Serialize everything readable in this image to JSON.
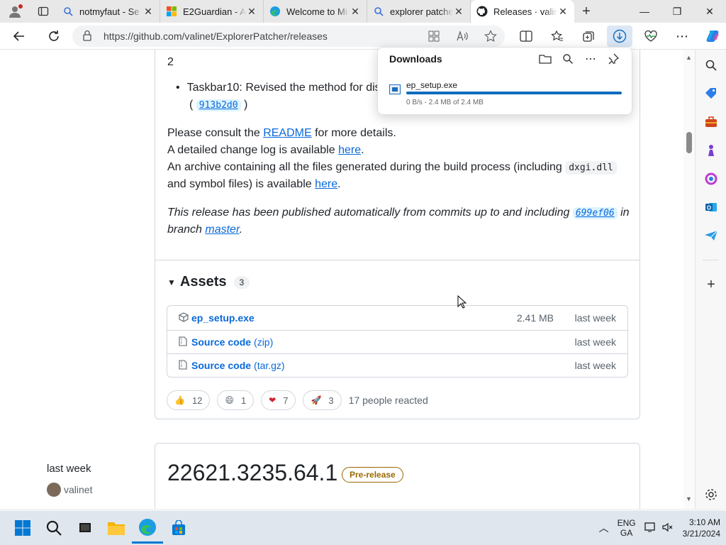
{
  "browser": {
    "tabs": [
      {
        "title": "notmyfaut - Se",
        "icon": "search-icon"
      },
      {
        "title": "E2Guardian - A",
        "icon": "microsoft-icon"
      },
      {
        "title": "Welcome to Mi",
        "icon": "edge-icon"
      },
      {
        "title": "explorer patche",
        "icon": "search-icon"
      },
      {
        "title": "Releases · valin",
        "icon": "github-icon",
        "active": true
      }
    ],
    "url": "https://github.com/valinet/ExplorerPatcher/releases"
  },
  "downloads": {
    "title": "Downloads",
    "file_name": "ep_setup.exe",
    "status": "0 B/s - 2.4 MB of 2.4 MB",
    "progress": 1.0
  },
  "release": {
    "top_number": "2",
    "bullet": "Taskbar10: Revised the method for dis",
    "bullet_sha": "913b2d0",
    "p1_pre": "Please consult the ",
    "p1_link": "README",
    "p1_post": " for more details.",
    "p2_pre": "A detailed change log is available ",
    "p2_link": "here",
    "p2_post": ".",
    "p3_pre": "An archive containing all the files generated during the build process (including ",
    "p3_code": "dxgi.dll",
    "p3_mid": "and symbol files) is available ",
    "p3_link": "here",
    "p3_post": ".",
    "p4_pre": "This release has been published automatically from commits up to and including ",
    "p4_sha": "699ef06",
    "p4_mid": " in",
    "p4_pre2": "branch ",
    "p4_link": "master",
    "p4_post": "."
  },
  "assets": {
    "title": "Assets",
    "count": "3",
    "items": [
      {
        "name": "ep_setup.exe",
        "suffix": "",
        "size": "2.41 MB",
        "date": "last week"
      },
      {
        "name": "Source code",
        "suffix": "(zip)",
        "size": "",
        "date": "last week"
      },
      {
        "name": "Source code",
        "suffix": "(tar.gz)",
        "size": "",
        "date": "last week"
      }
    ]
  },
  "reactions": {
    "items": [
      {
        "emoji": "👍",
        "count": "12"
      },
      {
        "emoji": "😄",
        "count": "1"
      },
      {
        "emoji": "❤",
        "count": "7"
      },
      {
        "emoji": "🚀",
        "count": "3"
      }
    ],
    "total": "17 people reacted"
  },
  "next_release": {
    "date": "last week",
    "author": "valinet",
    "version": "22621.3235.64.1",
    "badge": "Pre-release"
  },
  "taskbar": {
    "lang1": "ENG",
    "lang2": "GA",
    "time": "3:10 AM",
    "date": "3/21/2024"
  }
}
